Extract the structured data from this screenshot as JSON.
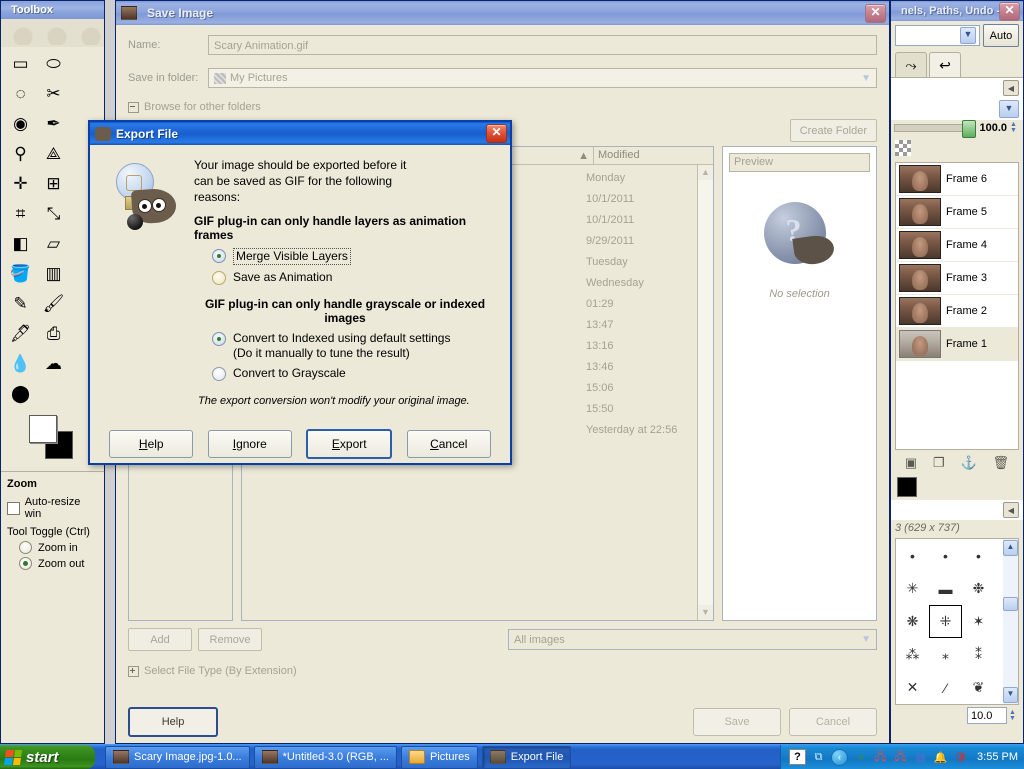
{
  "toolbox": {
    "title": "Toolbox",
    "tools": [
      "rect-select",
      "ellipse-select",
      "free-select",
      "scissors-select",
      "foreground-select",
      "paths",
      "color-picker",
      "measure",
      "move",
      "align",
      "crop",
      "rotate",
      "scale",
      "shear",
      "perspective",
      "flip",
      "bucket-fill",
      "blend",
      "pencil",
      "paintbrush",
      "eraser",
      "airbrush",
      "ink",
      "clone",
      "blur",
      "smudge",
      "dodge-burn"
    ],
    "options": {
      "heading": "Zoom",
      "auto_resize_label": "Auto-resize win",
      "tool_toggle_label": "Tool Toggle  (Ctrl)",
      "zoom_in_label": "Zoom in",
      "zoom_out_label": "Zoom out",
      "auto_resize_checked": false,
      "selected": "Zoom out"
    }
  },
  "save_dialog": {
    "title": "Save Image",
    "name_label": "Name:",
    "name_value": "Scary Animation.gif",
    "folder_label": "Save in folder:",
    "folder_value": "My Pictures",
    "browse_label": "Browse for other folders",
    "create_folder_label": "Create Folder",
    "columns": {
      "name": "",
      "modified": "Modified"
    },
    "modified_rows": [
      "Monday",
      "10/1/2011",
      "10/1/2011",
      "9/29/2011",
      "Tuesday",
      "Wednesday",
      "01:29",
      "13:47",
      "13:16",
      "13:46",
      "15:06",
      "15:50",
      "Yesterday at 22:56"
    ],
    "preview_label": "Preview",
    "preview_empty": "No selection",
    "add_label": "Add",
    "remove_label": "Remove",
    "filter_value": "All images",
    "filetype_label": "Select File Type (By Extension)",
    "help_label": "Help",
    "save_label": "Save",
    "cancel_label": "Cancel"
  },
  "export_dialog": {
    "title": "Export File",
    "intro_line1": "Your image should be exported before it",
    "intro_line2": "can be saved as GIF for the following",
    "intro_line3": "reasons:",
    "group1_heading": "GIF plug-in can only handle layers as animation frames",
    "option_merge": "Merge Visible Layers",
    "option_animation": "Save as Animation",
    "group1_selected": "Merge Visible Layers",
    "group2_heading": "GIF plug-in can only handle grayscale or indexed images",
    "option_indexed_line1": "Convert to Indexed using default settings",
    "option_indexed_line2": "(Do it manually to tune the result)",
    "option_grayscale": "Convert to Grayscale",
    "group2_selected": "Convert to Indexed using default settings",
    "note": "The export conversion won't modify your original image.",
    "buttons": {
      "help": "Help",
      "ignore": "Ignore",
      "export": "Export",
      "cancel": "Cancel",
      "default": "Export"
    }
  },
  "dock": {
    "title": "nels, Paths, Undo -...",
    "auto_label": "Auto",
    "opacity_value": "100.0",
    "layers": [
      {
        "name": "Frame 6",
        "selected": false
      },
      {
        "name": "Frame 5",
        "selected": false
      },
      {
        "name": "Frame 4",
        "selected": false
      },
      {
        "name": "Frame 3",
        "selected": false
      },
      {
        "name": "Frame 2",
        "selected": false
      },
      {
        "name": "Frame 1",
        "selected": true
      }
    ],
    "layer_buttons": [
      "new-layer-icon",
      "duplicate-layer-icon",
      "anchor-layer-icon",
      "delete-layer-icon"
    ],
    "brush_header": "3 (629 x 737)",
    "brush_size": "10.0"
  },
  "taskbar": {
    "start_label": "start",
    "tasks": [
      {
        "label": "Scary Image.jpg-1.0...",
        "icon": "image-icon",
        "active": false
      },
      {
        "label": "*Untitled-3.0 (RGB, ...",
        "icon": "image-icon",
        "active": false
      },
      {
        "label": "Pictures",
        "icon": "folder-icon",
        "active": false
      },
      {
        "label": "Export File",
        "icon": "gimp-icon",
        "active": true
      }
    ],
    "clock": "3:55 PM",
    "tray_icons": [
      "help-icon",
      "updates-icon",
      "chevron-left-icon",
      "messenger-icon",
      "network-icon",
      "network2-icon",
      "display-icon",
      "security-alert-icon",
      "shield-icon"
    ]
  },
  "colors": {
    "accent_blue": "#1e63d4",
    "dialog_bg": "#ece9d8",
    "taskbar_blue": "#225fc6",
    "start_green": "#2f8418"
  }
}
